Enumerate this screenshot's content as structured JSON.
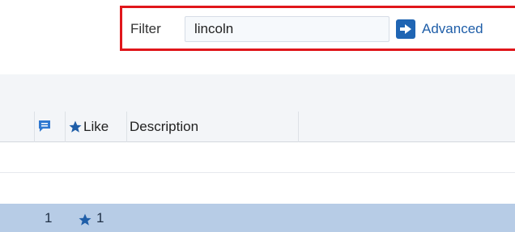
{
  "filter": {
    "label": "Filter",
    "value": "lincoln",
    "advanced_label": "Advanced"
  },
  "table": {
    "columns": {
      "comments_icon": "comment-icon",
      "like_icon": "star-icon",
      "like_label": "Like",
      "description_label": "Description"
    },
    "rows": [
      {
        "comments": "1",
        "likes": "1",
        "like_icon": "star-icon",
        "selected": true
      }
    ]
  },
  "colors": {
    "accent": "#1f65b3",
    "highlight_border": "#e0161b",
    "selected_row": "#b7cce6"
  }
}
